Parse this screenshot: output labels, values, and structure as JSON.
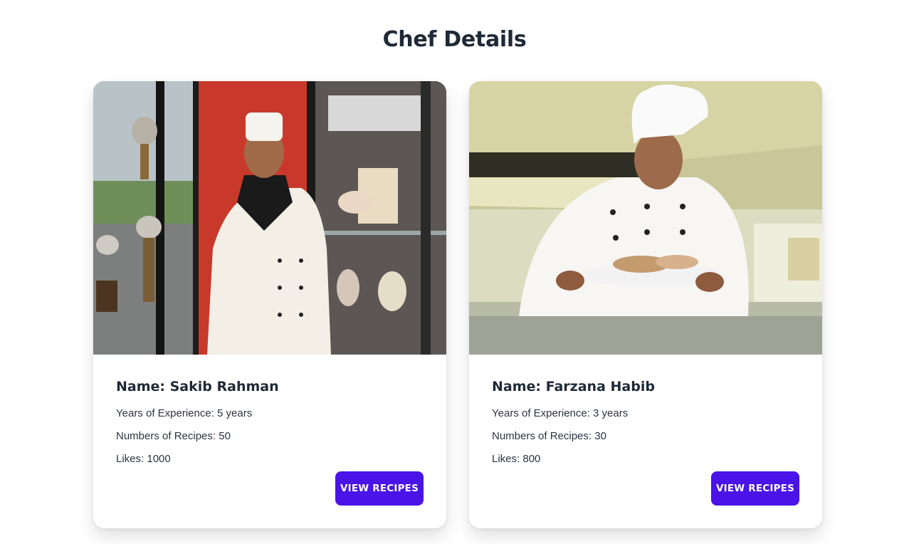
{
  "page": {
    "title": "Chef Details"
  },
  "chefs": [
    {
      "name_label": "Name:",
      "name": "Sakib Rahman",
      "experience": "Years of Experience: 5 years",
      "recipes": "Numbers of Recipes: 50",
      "likes": "Likes: 1000",
      "button": "VIEW RECIPES"
    },
    {
      "name_label": "Name:",
      "name": "Farzana Habib",
      "experience": "Years of Experience: 3 years",
      "recipes": "Numbers of Recipes: 30",
      "likes": "Likes: 800",
      "button": "VIEW RECIPES"
    }
  ],
  "colors": {
    "button": "#4a13e8",
    "title": "#1f2937"
  }
}
